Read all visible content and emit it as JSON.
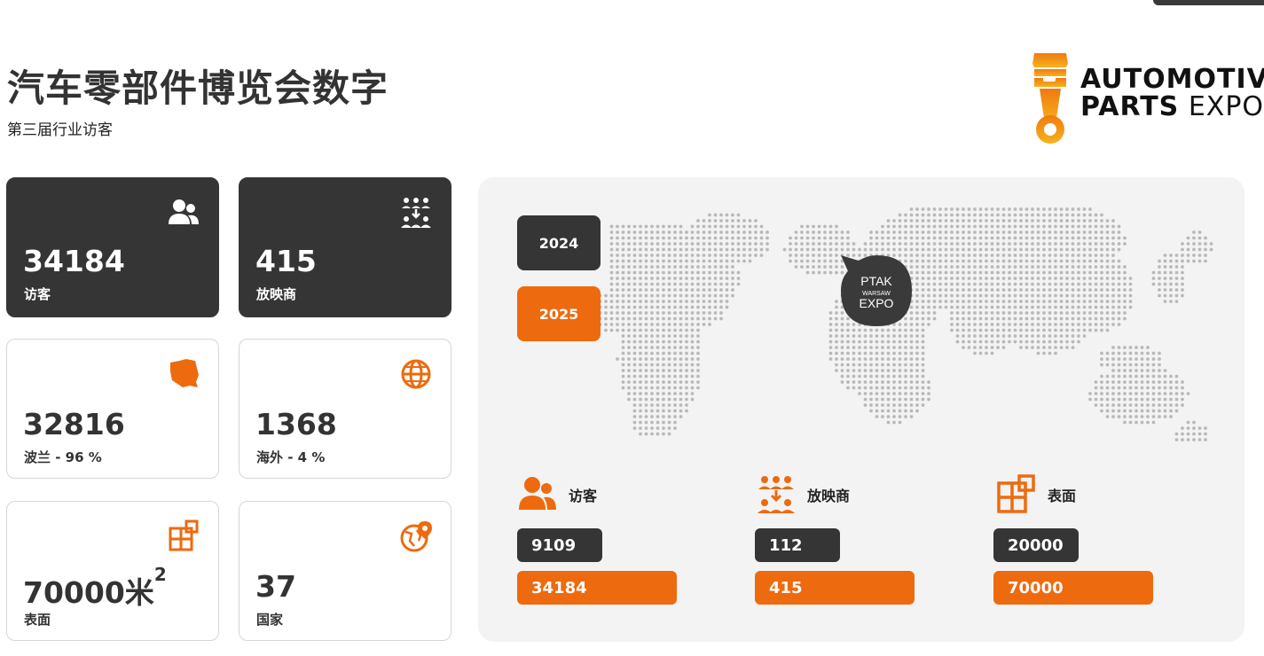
{
  "header": {
    "title": "汽车零部件博览会数字",
    "subtitle": "第三届行业访客"
  },
  "logo": {
    "line1": "AUTOMOTIVE",
    "line2_bold": "PARTS",
    "line2_light": "EXPO"
  },
  "cards": [
    {
      "value": "34184",
      "label": "访客",
      "icon": "visitors-icon"
    },
    {
      "value": "415",
      "label": "放映商",
      "icon": "exhibitors-icon"
    },
    {
      "value": "32816",
      "label": "波兰 - 96 %",
      "icon": "poland-map-icon"
    },
    {
      "value": "1368",
      "label": "海外 - 4 %",
      "icon": "globe-icon"
    },
    {
      "value": "70000米",
      "value_sup": "2",
      "label": "表面",
      "icon": "floor-plan-icon"
    },
    {
      "value": "37",
      "label": "国家",
      "icon": "globe-pin-icon"
    }
  ],
  "map": {
    "years": [
      "2024",
      "2025"
    ],
    "selected_year": "2025",
    "marker": {
      "line1": "PTAK",
      "line2": "WARSAW",
      "line3": "EXPO"
    }
  },
  "comparison": [
    {
      "title": "访客",
      "icon": "visitors-icon",
      "value_2024": "9109",
      "value_2025": "34184"
    },
    {
      "title": "放映商",
      "icon": "exhibitors-icon",
      "value_2024": "112",
      "value_2025": "415"
    },
    {
      "title": "表面",
      "icon": "floor-plan-icon",
      "value_2024": "20000",
      "value_2025": "70000"
    }
  ],
  "colors": {
    "accent": "#ee6a0e",
    "dark": "#353535",
    "panel": "#f3f3f3",
    "dots": "#b9b9b9"
  }
}
